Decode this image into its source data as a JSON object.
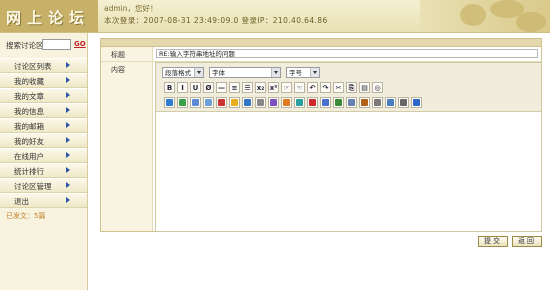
{
  "header": {
    "logo_text": "网上论坛",
    "welcome": "admin，您好！",
    "login_info": "本次登录：2007-08-31 23:49:09.0  登录IP：210.40.64.86"
  },
  "sidebar": {
    "search_label": "搜索讨论区",
    "search_value": "",
    "search_go": "GO",
    "items": [
      {
        "label": "讨论区列表"
      },
      {
        "label": "我的收藏"
      },
      {
        "label": "我的文章"
      },
      {
        "label": "我的信息"
      },
      {
        "label": "我的邮箱"
      },
      {
        "label": "我的好友"
      },
      {
        "label": "在线用户"
      },
      {
        "label": "统计排行"
      },
      {
        "label": "讨论区管理"
      },
      {
        "label": "退出"
      }
    ],
    "posted": "已发文：5篇"
  },
  "form": {
    "title_label": "标题",
    "title_value": "RE:输入字符串地址的问题",
    "content_label": "内容",
    "paragraph_select": "段落格式",
    "font_select": "字体",
    "size_select": "字号"
  },
  "toolbar": {
    "row1": [
      "B",
      "I",
      "U",
      "Ø",
      "—",
      "≡",
      "☰",
      "x₂",
      "x²",
      "☞",
      "☜",
      "↶",
      "↷",
      "✂",
      "⎘",
      "▤",
      "◎"
    ],
    "row2_icons": [
      {
        "name": "link-icon",
        "color": "#2e7bd3"
      },
      {
        "name": "image-icon",
        "color": "#3aa04a"
      },
      {
        "name": "table-icon",
        "color": "#5d8ad6"
      },
      {
        "name": "hr-icon",
        "color": "#6aa2d8"
      },
      {
        "name": "flash-icon",
        "color": "#cc3333"
      },
      {
        "name": "smiley-icon",
        "color": "#e8b020"
      },
      {
        "name": "media-icon",
        "color": "#3474c8"
      },
      {
        "name": "frame-icon",
        "color": "#888888"
      },
      {
        "name": "special-char-icon",
        "color": "#7d4fc0"
      },
      {
        "name": "marquee-icon",
        "color": "#e07a20"
      },
      {
        "name": "color-icon",
        "color": "#2aa0a0"
      },
      {
        "name": "delete-icon",
        "color": "#cc2a2a"
      },
      {
        "name": "edit-icon",
        "color": "#4a6ecb"
      },
      {
        "name": "sort-icon",
        "color": "#3a8c3a"
      },
      {
        "name": "trash-icon",
        "color": "#6680b0"
      },
      {
        "name": "code-icon",
        "color": "#b0621c"
      },
      {
        "name": "quote-icon",
        "color": "#7a7a7a"
      },
      {
        "name": "preview-icon",
        "color": "#4a7ac0"
      },
      {
        "name": "print-icon",
        "color": "#666666"
      },
      {
        "name": "help-icon",
        "color": "#2d66c8"
      }
    ]
  },
  "actions": {
    "submit": "提交",
    "back": "返回"
  }
}
